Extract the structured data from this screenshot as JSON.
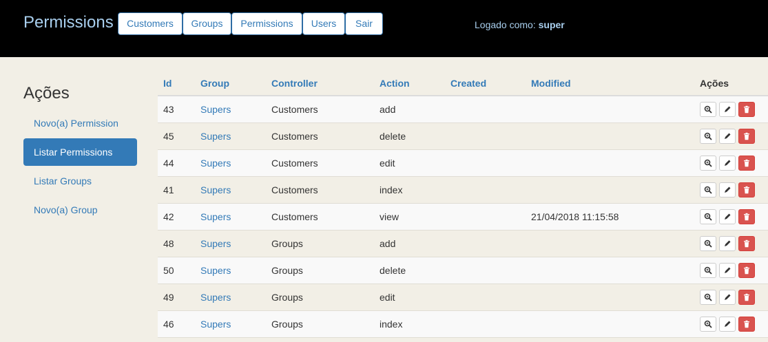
{
  "header": {
    "brand": "Permissions",
    "nav": [
      "Customers",
      "Groups",
      "Permissions",
      "Users",
      "Sair"
    ],
    "login_label": "Logado como:",
    "login_user": "super"
  },
  "sidebar": {
    "title": "Ações",
    "items": [
      {
        "label": "Novo(a) Permission",
        "active": false
      },
      {
        "label": "Listar Permissions",
        "active": true
      },
      {
        "label": "Listar Groups",
        "active": false
      },
      {
        "label": "Novo(a) Group",
        "active": false
      }
    ]
  },
  "table": {
    "columns": [
      "Id",
      "Group",
      "Controller",
      "Action",
      "Created",
      "Modified",
      "Ações"
    ],
    "rows": [
      {
        "id": "43",
        "group": "Supers",
        "controller": "Customers",
        "action": "add",
        "created": "",
        "modified": ""
      },
      {
        "id": "45",
        "group": "Supers",
        "controller": "Customers",
        "action": "delete",
        "created": "",
        "modified": ""
      },
      {
        "id": "44",
        "group": "Supers",
        "controller": "Customers",
        "action": "edit",
        "created": "",
        "modified": ""
      },
      {
        "id": "41",
        "group": "Supers",
        "controller": "Customers",
        "action": "index",
        "created": "",
        "modified": ""
      },
      {
        "id": "42",
        "group": "Supers",
        "controller": "Customers",
        "action": "view",
        "created": "",
        "modified": "21/04/2018 11:15:58"
      },
      {
        "id": "48",
        "group": "Supers",
        "controller": "Groups",
        "action": "add",
        "created": "",
        "modified": ""
      },
      {
        "id": "50",
        "group": "Supers",
        "controller": "Groups",
        "action": "delete",
        "created": "",
        "modified": ""
      },
      {
        "id": "49",
        "group": "Supers",
        "controller": "Groups",
        "action": "edit",
        "created": "",
        "modified": ""
      },
      {
        "id": "46",
        "group": "Supers",
        "controller": "Groups",
        "action": "index",
        "created": "",
        "modified": ""
      }
    ],
    "row_actions": [
      "view-icon",
      "edit-icon",
      "delete-icon"
    ]
  },
  "colors": {
    "topbar": "#000000",
    "brand": "#a9cfee",
    "link": "#337ab7",
    "active": "#337ab7",
    "danger": "#d9534f",
    "background": "#f2efe6"
  }
}
